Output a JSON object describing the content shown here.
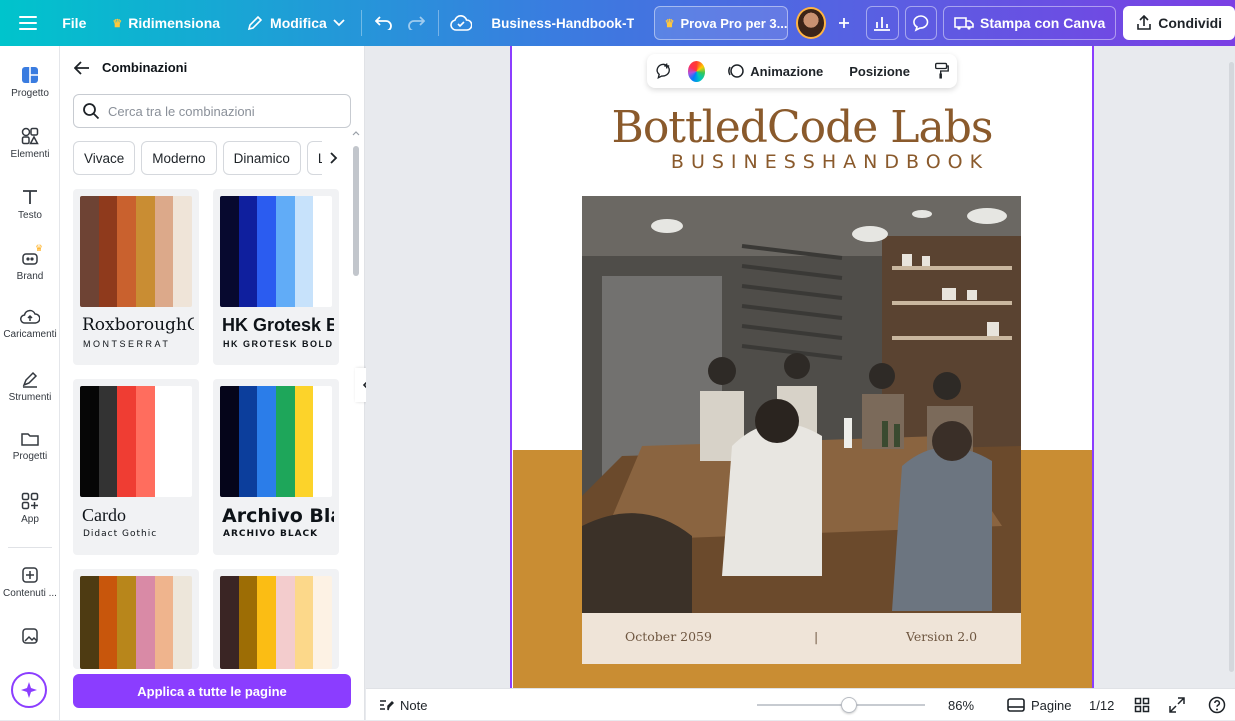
{
  "topbar": {
    "file_label": "File",
    "resize_label": "Ridimensiona",
    "edit_label": "Modifica",
    "doc_title": "Business-Handbook-Temp...",
    "pro_label": "Prova Pro per 3...",
    "print_label": "Stampa con Canva",
    "share_label": "Condividi"
  },
  "rail": {
    "items": [
      "Progetto",
      "Elementi",
      "Testo",
      "Brand",
      "Caricamenti",
      "Strumenti",
      "Progetti",
      "App",
      "Contenuti ..."
    ]
  },
  "panel": {
    "title": "Combinazioni",
    "search_placeholder": "Cerca tra le combinazioni",
    "chips": [
      "Vivace",
      "Moderno",
      "Dinamico",
      "Luminoso"
    ],
    "cards": [
      {
        "font1": "RoxboroughCF",
        "font2": "MONTSERRAT",
        "colors": [
          "#6e4334",
          "#8f3a1c",
          "#c9612e",
          "#c98d33",
          "#dca98a",
          "#efe4d8"
        ]
      },
      {
        "font1": "HK Grotesk Bold",
        "font2": "HK GROTESK BOLD",
        "colors": [
          "#07092f",
          "#0f1f9e",
          "#2b5cf0",
          "#61acf7",
          "#c7e2fb",
          "#ffffff"
        ]
      },
      {
        "font1": "Cardo",
        "font2": "Didact Gothic",
        "colors": [
          "#060606",
          "#333333",
          "#ef3d33",
          "#ff6d5e",
          "#ffffff",
          "#ffffff"
        ]
      },
      {
        "font1": "Archivo Black",
        "font2": "ARCHIVO BLACK",
        "colors": [
          "#05051a",
          "#0c3e9c",
          "#2b7de9",
          "#1ea65a",
          "#fcd32a",
          "#ffffff"
        ]
      },
      {
        "font1": "",
        "font2": "",
        "colors": [
          "#4e3b12",
          "#c8560c",
          "#b8861b",
          "#d98aa6",
          "#efb48d",
          "#ede6da"
        ]
      },
      {
        "font1": "",
        "font2": "",
        "colors": [
          "#3a2524",
          "#9d6d05",
          "#fbbd14",
          "#f3cccd",
          "#fcd88a",
          "#fdf2e4"
        ]
      }
    ],
    "apply_label": "Applica a tutte le pagine"
  },
  "floatbar": {
    "animation_label": "Animazione",
    "position_label": "Posizione"
  },
  "page": {
    "title": "BottledCode Labs",
    "subtitle": "BUSINESSHANDBOOK",
    "date": "October 2059",
    "separator": "|",
    "version": "Version 2.0"
  },
  "bottombar": {
    "notes_label": "Note",
    "zoom": "86%",
    "pages_label": "Pagine",
    "page_count": "1/12"
  },
  "colors": {
    "accent": "#8b3dff",
    "brand_brown": "#8a5a2c",
    "page_orange": "#c98d33"
  }
}
